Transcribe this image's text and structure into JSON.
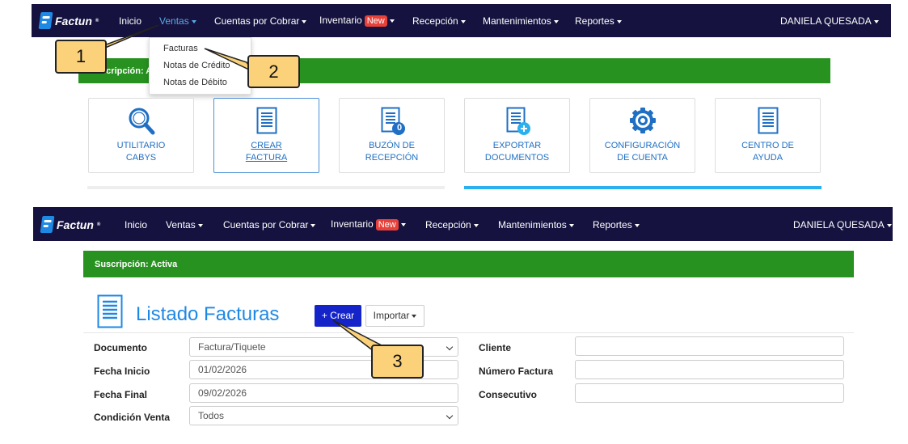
{
  "brand": {
    "name": "Factun",
    "mark": "®"
  },
  "nav_top": {
    "items": [
      {
        "label": "Inicio"
      },
      {
        "label": "Ventas"
      },
      {
        "label": "Cuentas por Cobrar"
      },
      {
        "label": "Inventario"
      },
      {
        "label": "Recepción"
      },
      {
        "label": "Mantenimientos"
      },
      {
        "label": "Reportes"
      }
    ],
    "badge": "New",
    "user": "DANIELA QUESADA",
    "active": "Ventas"
  },
  "dropdown": {
    "items": [
      "Facturas",
      "Notas de Crédito",
      "Notas de Débito"
    ]
  },
  "subscription_partial": "Suscripción: A",
  "cards": [
    {
      "line1": "UTILITARIO",
      "line2": "CABYS",
      "icon": "search-icon"
    },
    {
      "line1": "CREAR",
      "line2": "FACTURA",
      "icon": "document-icon"
    },
    {
      "line1": "BUZÓN DE",
      "line2": "RECEPCIÓN",
      "icon": "inbox-document-icon",
      "count": "0"
    },
    {
      "line1": "EXPORTAR",
      "line2": "DOCUMENTOS",
      "icon": "export-document-icon"
    },
    {
      "line1": "CONFIGURACIÓN",
      "line2": "DE CUENTA",
      "icon": "gear-icon"
    },
    {
      "line1": "CENTRO DE",
      "line2": "AYUDA",
      "icon": "help-document-icon"
    }
  ],
  "subscription": "Suscripción: Activa",
  "page": {
    "title": "Listado Facturas",
    "create_label": "+ Crear",
    "import_label": "Importar"
  },
  "filters": {
    "documento": {
      "label": "Documento",
      "value": "Factura/Tiquete"
    },
    "fecha_inicio": {
      "label": "Fecha Inicio",
      "value": "01/02/2026"
    },
    "fecha_final": {
      "label": "Fecha Final",
      "value": "09/02/2026"
    },
    "condicion_venta": {
      "label": "Condición Venta",
      "value": "Todos"
    },
    "cliente": {
      "label": "Cliente",
      "value": ""
    },
    "numero_factura": {
      "label": "Número Factura",
      "value": ""
    },
    "consecutivo": {
      "label": "Consecutivo",
      "value": ""
    }
  },
  "callouts": [
    "1",
    "2",
    "3"
  ],
  "colors": {
    "navbar": "#15123f",
    "green": "#27921f",
    "accent_blue": "#1e88e5",
    "button_blue": "#1424c9",
    "callout": "#fbd27a",
    "badge_red": "#e8413a"
  }
}
